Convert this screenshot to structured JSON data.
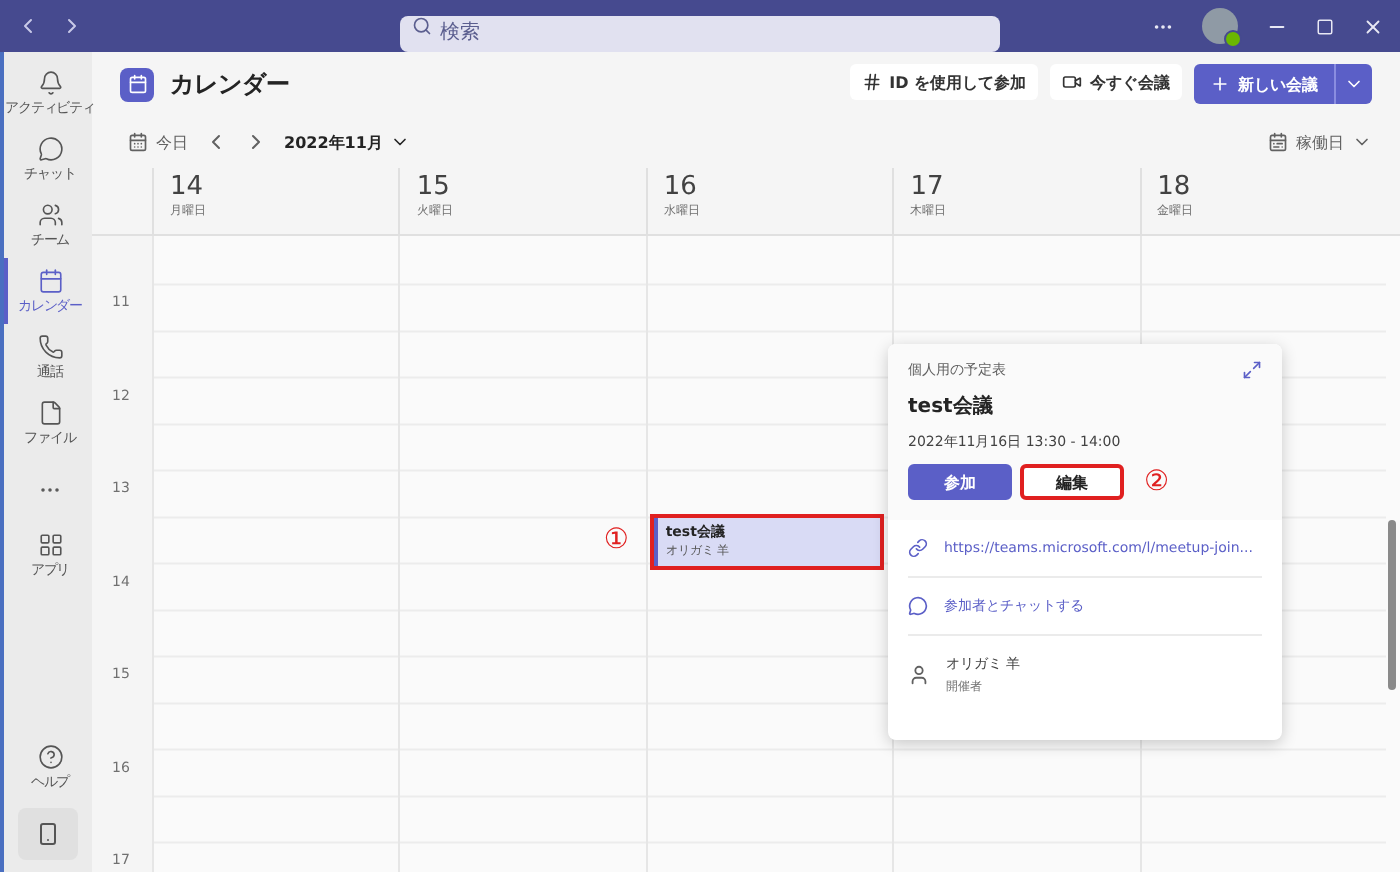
{
  "titlebar": {
    "search": {
      "placeholder": "検索"
    }
  },
  "rail": {
    "items": [
      {
        "label": "アクティビティ",
        "selected": false
      },
      {
        "label": "チャット",
        "selected": false
      },
      {
        "label": "チーム",
        "selected": false
      },
      {
        "label": "カレンダー",
        "selected": true
      },
      {
        "label": "通話",
        "selected": false
      },
      {
        "label": "ファイル",
        "selected": false
      },
      {
        "kind": "more",
        "selected": false
      },
      {
        "label": "アプリ",
        "selected": false
      }
    ],
    "bottom": [
      {
        "label": "ヘルプ"
      }
    ]
  },
  "header": {
    "title": "カレンダー",
    "buttons": [
      {
        "label": "ID を使用して参加",
        "kind": "hash"
      },
      {
        "label": "今すぐ会議",
        "kind": "video"
      }
    ],
    "new_meeting": {
      "label": "新しい会議"
    }
  },
  "toolbar": {
    "today": "今日",
    "month": "2022年11月",
    "view": "稼働日"
  },
  "hours": [
    "11",
    "12",
    "13",
    "14",
    "15",
    "16",
    "17"
  ],
  "days": [
    {
      "date": "14",
      "weekday": "月曜日"
    },
    {
      "date": "15",
      "weekday": "火曜日"
    },
    {
      "date": "16",
      "weekday": "水曜日",
      "events": [
        {
          "title": "test会議",
          "organizer": "オリガミ 羊",
          "highlighted": true,
          "marker": "①"
        }
      ]
    },
    {
      "date": "17",
      "weekday": "木曜日"
    },
    {
      "date": "18",
      "weekday": "金曜日"
    }
  ],
  "popup": {
    "calendar": "個人用の予定表",
    "title": "test会議",
    "time": "2022年11月16日 13:30 - 14:00",
    "buttons": [
      {
        "label": "参加",
        "kind": "primary",
        "highlighted": false
      },
      {
        "label": "編集",
        "kind": "secondary",
        "highlighted": true,
        "marker": "②"
      }
    ],
    "link": "https://teams.microsoft.com/l/meetup-join...",
    "chat": "参加者とチャットする",
    "organizer": {
      "name": "オリガミ 羊",
      "role": "開催者"
    }
  }
}
